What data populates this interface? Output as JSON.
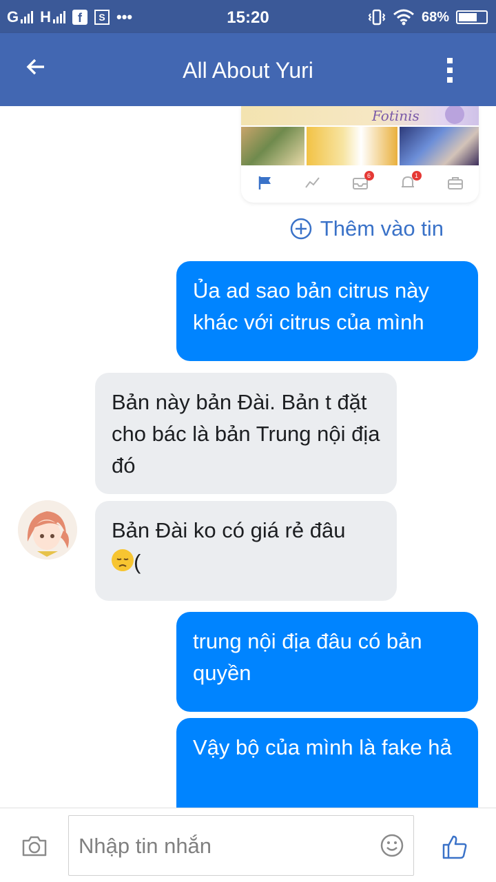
{
  "status_bar": {
    "network_1": "G",
    "network_2": "H",
    "time": "15:20",
    "battery_percent": "68%",
    "battery_level": 0.68,
    "dots": "•••",
    "icons": [
      "signal-icon",
      "facebook-icon",
      "screenshot-icon",
      "vibrate-icon",
      "wifi-icon",
      "battery-icon"
    ]
  },
  "header": {
    "title": "All About Yuri",
    "back_icon": "arrow-left-icon",
    "menu_icon": "more-vert-icon"
  },
  "preview": {
    "badge_1": "6",
    "badge_2": "1",
    "icons": [
      "flag-icon",
      "chart-icon",
      "inbox-icon",
      "bell-icon",
      "briefcase-icon"
    ]
  },
  "add_story": {
    "label": "Thêm vào tin",
    "icon": "plus-circle-icon"
  },
  "messages": [
    {
      "side": "out",
      "text": "Ủa ad sao bản citrus này khác với citrus của mình"
    },
    {
      "side": "in",
      "text": "Bản này bản Đài. Bản t đặt cho bác là bản Trung nội địa đó"
    },
    {
      "side": "in",
      "text": "Bản Đài ko có giá rẻ đâu",
      "suffix": "(",
      "emoji": "disappointed-face"
    },
    {
      "side": "out",
      "text": "trung nội địa đâu có bản quyền"
    },
    {
      "side": "out",
      "text": "Vậy bộ của mình là fake hả"
    }
  ],
  "input": {
    "placeholder": "Nhập tin nhắn",
    "camera_icon": "camera-icon",
    "emoji_icon": "smiley-icon",
    "like_icon": "thumbs-up-icon"
  },
  "colors": {
    "status_bar": "#3b5998",
    "header": "#4267b2",
    "outgoing_bubble": "#0084ff",
    "incoming_bubble": "#ebedf0",
    "accent": "#3a72c8"
  }
}
